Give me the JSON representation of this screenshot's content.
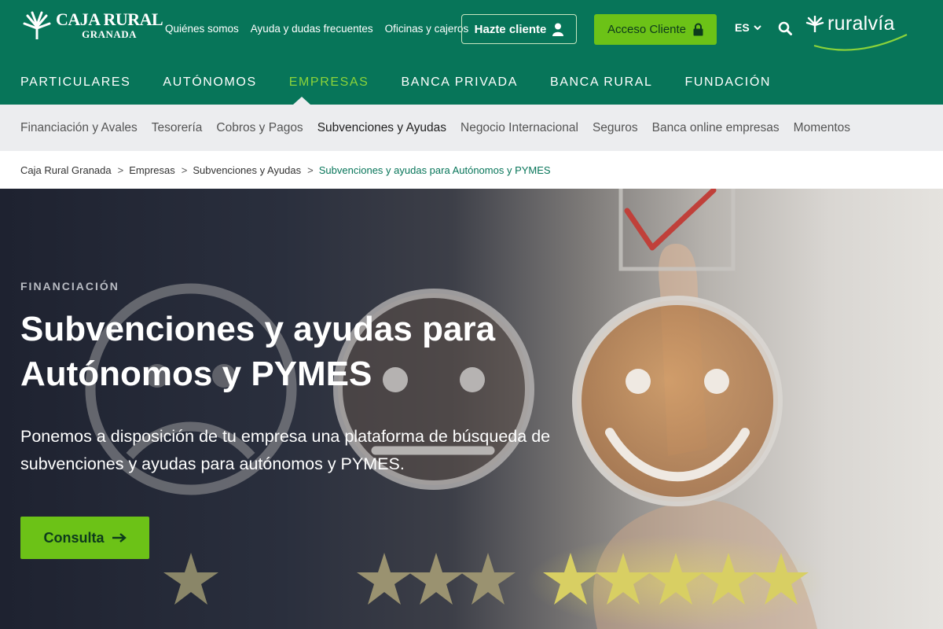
{
  "brand": {
    "name": "CAJA RURAL",
    "sub": "GRANADA",
    "ruralvia": "ruralvía"
  },
  "utility_links": [
    "Quiénes somos",
    "Ayuda y dudas frecuentes",
    "Oficinas y cajeros"
  ],
  "header": {
    "hazte_label": "Hazte cliente",
    "acceso_label": "Acceso Cliente",
    "lang": "ES"
  },
  "main_nav": [
    {
      "label": "PARTICULARES",
      "active": false
    },
    {
      "label": "AUTÓNOMOS",
      "active": false
    },
    {
      "label": "EMPRESAS",
      "active": true
    },
    {
      "label": "BANCA PRIVADA",
      "active": false
    },
    {
      "label": "BANCA RURAL",
      "active": false
    },
    {
      "label": "FUNDACIÓN",
      "active": false
    }
  ],
  "sub_nav": [
    {
      "label": "Financiación y Avales",
      "active": false
    },
    {
      "label": "Tesorería",
      "active": false
    },
    {
      "label": "Cobros y Pagos",
      "active": false
    },
    {
      "label": "Subvenciones y Ayudas",
      "active": true
    },
    {
      "label": "Negocio Internacional",
      "active": false
    },
    {
      "label": "Seguros",
      "active": false
    },
    {
      "label": "Banca online empresas",
      "active": false
    },
    {
      "label": "Momentos",
      "active": false
    }
  ],
  "breadcrumb": {
    "separator": ">",
    "items": [
      "Caja Rural Granada",
      "Empresas",
      "Subvenciones y Ayudas",
      "Subvenciones y ayudas para Autónomos y PYMES"
    ]
  },
  "hero": {
    "eyebrow": "FINANCIACIÓN",
    "title_line1": "Subvenciones y ayudas para",
    "title_line2": "Autónomos y PYMES",
    "text_line1": "Ponemos a disposición de tu empresa una plataforma de búsqueda de",
    "text_line2": "subvenciones y ayudas para autónomos y PYMES.",
    "cta_label": "Consulta"
  },
  "colors": {
    "brand_green": "#077559",
    "accent_green": "#6cc217",
    "active_nav": "#8cd43a",
    "subnav_bg": "#ecedef"
  },
  "icons": [
    "caja-rural-logo-icon",
    "user-icon",
    "lock-icon",
    "chevron-down-icon",
    "search-icon",
    "ruralvia-logo-icon",
    "arrow-right-icon"
  ]
}
